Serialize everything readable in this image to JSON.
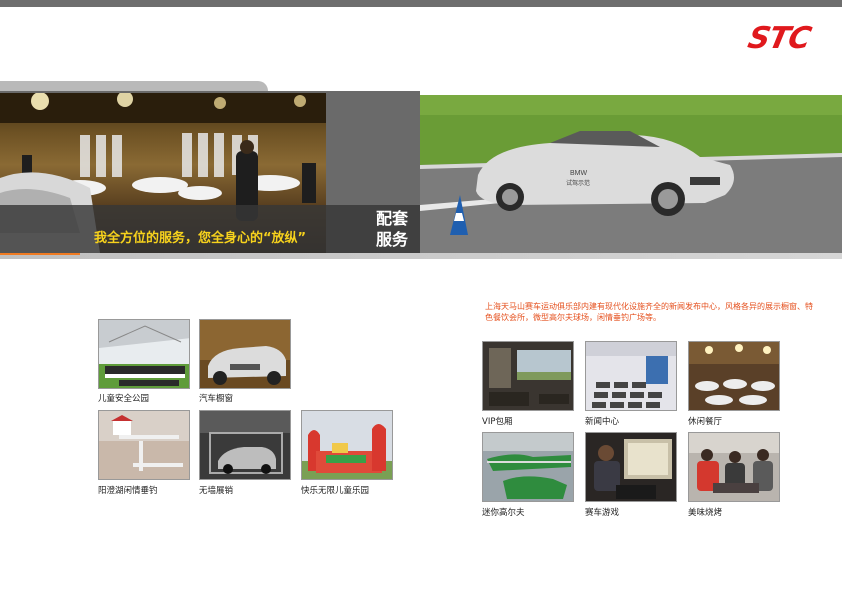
{
  "brand": {
    "logo_text": "STC",
    "logo_color": "#e0191d"
  },
  "banner": {
    "caption": "我全方位的服务，您全身心的“放纵”",
    "section_title_line1": "配套",
    "section_title_line2": "服务",
    "car_badge": "BMW",
    "car_badge_sub": "试驾示范"
  },
  "description": "上海天马山赛车运动俱乐部内建有现代化设施齐全的新闻发布中心，风格各异的展示橱窗、特色餐饮会所，微型高尔夫球场，闲情垂钓广场等。",
  "left_gallery": [
    {
      "label": "儿童安全公园"
    },
    {
      "label": "汽车橱窗"
    },
    {
      "label": "阳澄湖闲情垂钓"
    },
    {
      "label": "无墙展销"
    },
    {
      "label": "快乐无限儿童乐园"
    }
  ],
  "right_gallery": [
    {
      "label": "VIP包厢"
    },
    {
      "label": "新闻中心"
    },
    {
      "label": "休闲餐厅"
    },
    {
      "label": "迷你高尔夫"
    },
    {
      "label": "赛车游戏"
    },
    {
      "label": "美味烧烤"
    }
  ],
  "colors": {
    "accent": "#f07b22",
    "caption_yellow": "#f7d21c",
    "desc_orange": "#e5501e",
    "banner_gray": "#6a6a6a"
  }
}
